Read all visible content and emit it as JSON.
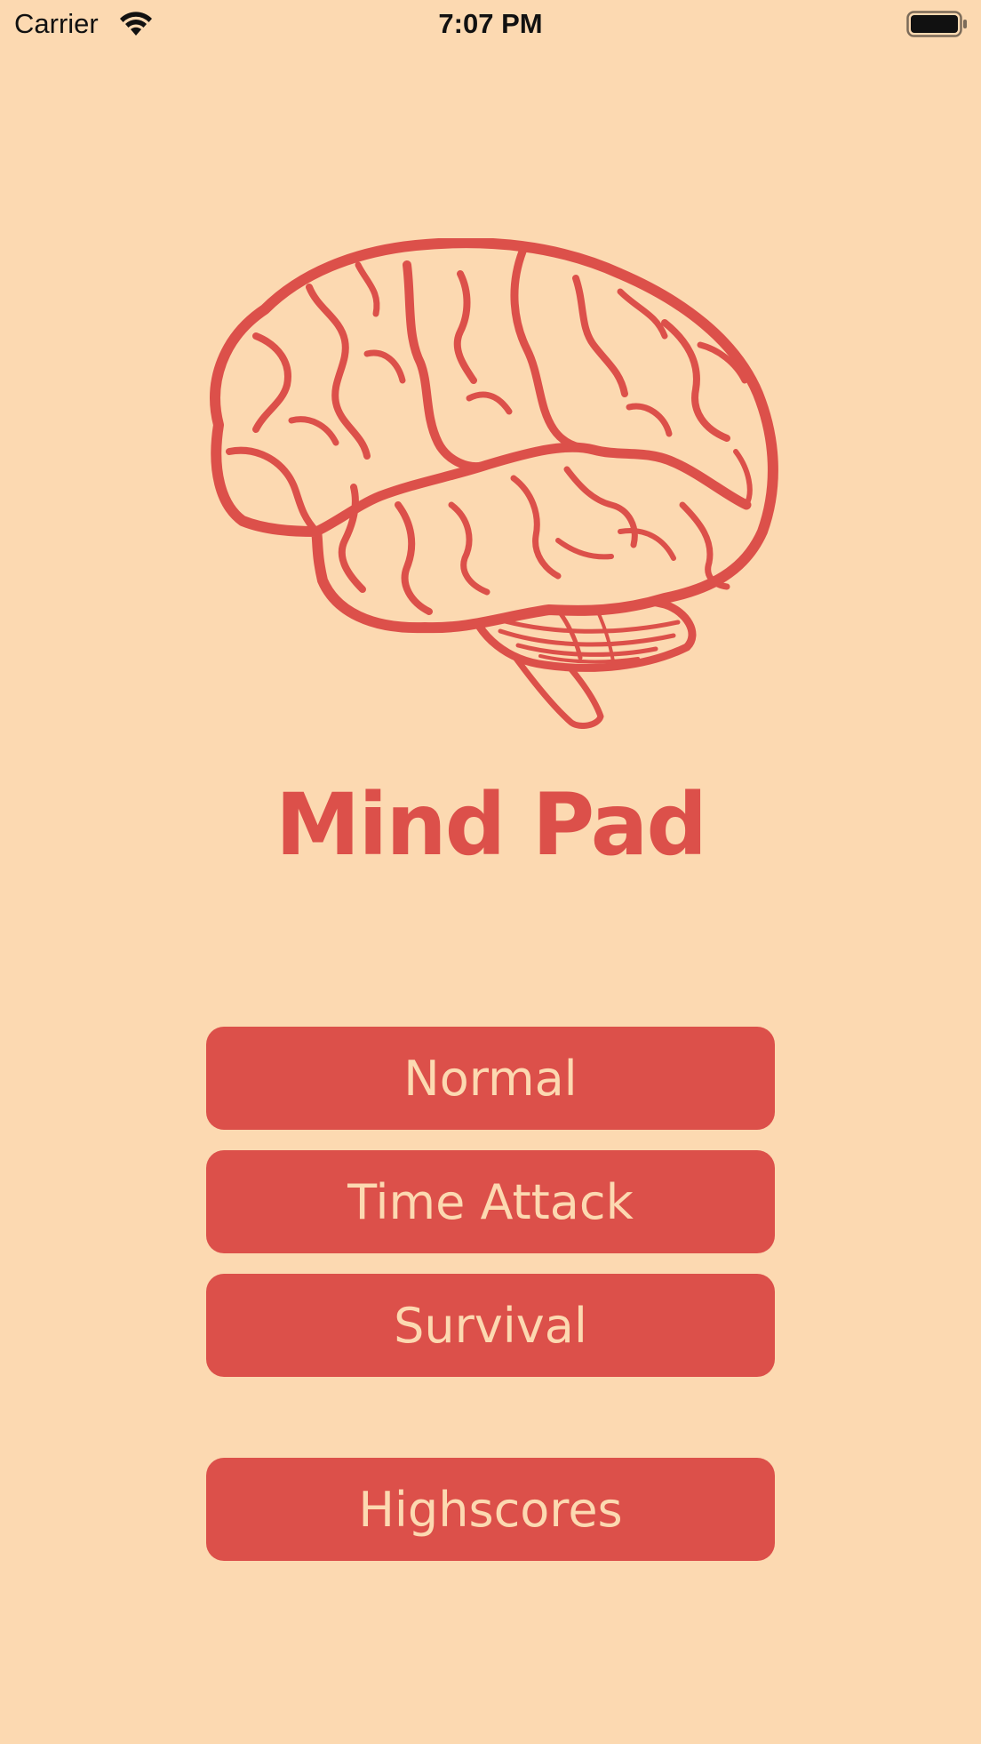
{
  "status_bar": {
    "carrier": "Carrier",
    "time": "7:07 PM",
    "icons": [
      "wifi-icon",
      "battery-icon"
    ]
  },
  "logo": {
    "icon": "brain-icon"
  },
  "app": {
    "title": "Mind Pad"
  },
  "menu": {
    "normal_label": "Normal",
    "time_attack_label": "Time Attack",
    "survival_label": "Survival",
    "highscores_label": "Highscores"
  },
  "colors": {
    "background": "#fcd9b1",
    "accent": "#dc504a",
    "button_text": "#fcd9b1"
  }
}
